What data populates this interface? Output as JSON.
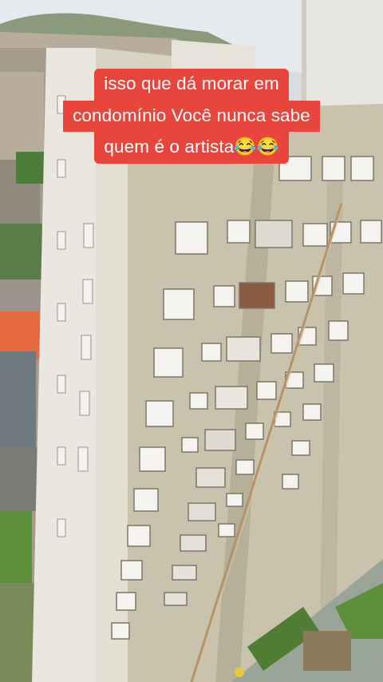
{
  "caption": {
    "lines": [
      "isso que dá morar em",
      "condomínio Você nunca sabe",
      "quem é o artista😂😂"
    ]
  },
  "colors": {
    "caption_bg": "#e8453c",
    "caption_text": "#ffffff",
    "building_facade": "#c9c3ad",
    "building_light": "#e6e3d8",
    "sky": "#dfe6ea",
    "grass": "#5d8f3a",
    "roof_orange": "#e46a3d"
  },
  "scene": {
    "description_icon": "building-photo"
  }
}
